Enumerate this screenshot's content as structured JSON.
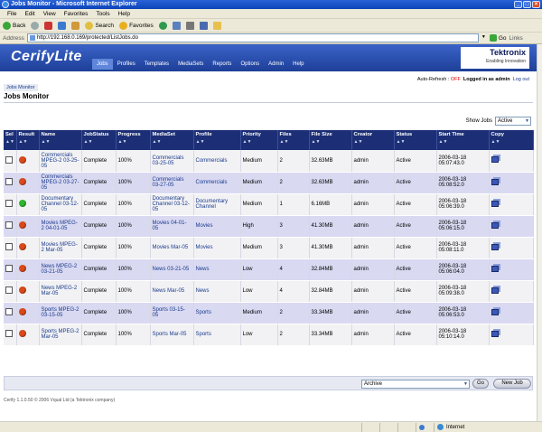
{
  "window": {
    "title": "Jobs Monitor - Microsoft Internet Explorer"
  },
  "menu": [
    "File",
    "Edit",
    "View",
    "Favorites",
    "Tools",
    "Help"
  ],
  "toolbar": {
    "back": "Back",
    "search": "Search",
    "favorites": "Favorites"
  },
  "address": {
    "label": "Address",
    "url": "http://192.168.0.169/protected/ListJobs.do",
    "go": "Go",
    "links": "Links"
  },
  "app": {
    "logo": "CerifyLite",
    "brand": "Tektronix",
    "tagline": "Enabling Innovation"
  },
  "nav": [
    {
      "label": "Jobs",
      "active": true
    },
    {
      "label": "Profiles"
    },
    {
      "label": "Templates"
    },
    {
      "label": "MediaSets"
    },
    {
      "label": "Reports"
    },
    {
      "label": "Options"
    },
    {
      "label": "Admin"
    },
    {
      "label": "Help"
    }
  ],
  "utility": {
    "autorefresh": "Auto-Refresh :",
    "off": "OFF",
    "logged_in": "Logged in as admin",
    "logout": "Log out"
  },
  "breadcrumb": "Jobs Monitor",
  "page_title": "Jobs Monitor",
  "show_jobs": {
    "label": "Show Jobs",
    "value": "Active"
  },
  "columns": [
    "Sel",
    "Result",
    "Name",
    "JobStatus",
    "Progress",
    "MediaSet",
    "Profile",
    "Priority",
    "Files",
    "File Size",
    "Creator",
    "Status",
    "Start Time",
    "Copy"
  ],
  "rows": [
    {
      "result": "red",
      "name": "Commercials MPEG-2 03-25-05",
      "jobstatus": "Complete",
      "progress": "100%",
      "mediaset": "Commercials 03-25-05",
      "profile": "Commercials",
      "priority": "Medium",
      "files": "2",
      "size": "32.63MB",
      "creator": "admin",
      "status": "Active",
      "start": "2006-03-18 05:07:43.0"
    },
    {
      "result": "red",
      "name": "Commercials MPEG-2 03-27-05",
      "jobstatus": "Complete",
      "progress": "100%",
      "mediaset": "Commercials 03-27-05",
      "profile": "Commercials",
      "priority": "Medium",
      "files": "2",
      "size": "32.63MB",
      "creator": "admin",
      "status": "Active",
      "start": "2006-03-18 05:08:52.0"
    },
    {
      "result": "green",
      "name": "Documentary Channel 03-12-05",
      "jobstatus": "Complete",
      "progress": "100%",
      "mediaset": "Documentary Channel 03-12-05",
      "profile": "Documentary Channel",
      "priority": "Medium",
      "files": "1",
      "size": "6.16MB",
      "creator": "admin",
      "status": "Active",
      "start": "2006-03-18 05:06:39.0"
    },
    {
      "result": "red",
      "name": "Movies MPEG-2 04-01-05",
      "jobstatus": "Complete",
      "progress": "100%",
      "mediaset": "Movies 04-01-05",
      "profile": "Movies",
      "priority": "High",
      "files": "3",
      "size": "41.30MB",
      "creator": "admin",
      "status": "Active",
      "start": "2006-03-18 05:06:15.0"
    },
    {
      "result": "red",
      "name": "Movies MPEG-2 Mar-05",
      "jobstatus": "Complete",
      "progress": "100%",
      "mediaset": "Movies Mar-05",
      "profile": "Movies",
      "priority": "Medium",
      "files": "3",
      "size": "41.30MB",
      "creator": "admin",
      "status": "Active",
      "start": "2006-03-18 05:08:11.0"
    },
    {
      "result": "red",
      "name": "News MPEG-2 03-21-05",
      "jobstatus": "Complete",
      "progress": "100%",
      "mediaset": "News 03-21-05",
      "profile": "News",
      "priority": "Low",
      "files": "4",
      "size": "32.84MB",
      "creator": "admin",
      "status": "Active",
      "start": "2006-03-18 05:06:04.0"
    },
    {
      "result": "red",
      "name": "News MPEG-2 Mar-05",
      "jobstatus": "Complete",
      "progress": "100%",
      "mediaset": "News Mar-05",
      "profile": "News",
      "priority": "Low",
      "files": "4",
      "size": "32.84MB",
      "creator": "admin",
      "status": "Active",
      "start": "2006-03-18 05:09:38.0"
    },
    {
      "result": "red",
      "name": "Sports MPEG-2 03-15-05",
      "jobstatus": "Complete",
      "progress": "100%",
      "mediaset": "Sports 03-15-05",
      "profile": "Sports",
      "priority": "Medium",
      "files": "2",
      "size": "33.34MB",
      "creator": "admin",
      "status": "Active",
      "start": "2006-03-18 05:06:53.0"
    },
    {
      "result": "red",
      "name": "Sports MPEG-2 Mar-05",
      "jobstatus": "Complete",
      "progress": "100%",
      "mediaset": "Sports Mar-05",
      "profile": "Sports",
      "priority": "Low",
      "files": "2",
      "size": "33.34MB",
      "creator": "admin",
      "status": "Active",
      "start": "2006-03-18 05:10:14.0"
    }
  ],
  "actions": {
    "select_value": "Archive",
    "go": "Go",
    "new_job": "New Job"
  },
  "footer": "Cerify 1.1.0.50 © 2006 Vqual Ltd (a Tektronix company)",
  "statusbar": {
    "zone": "Internet"
  },
  "colors": {
    "red": "#d84a1a",
    "green": "#2fb52f",
    "header": "#1c2f76"
  }
}
